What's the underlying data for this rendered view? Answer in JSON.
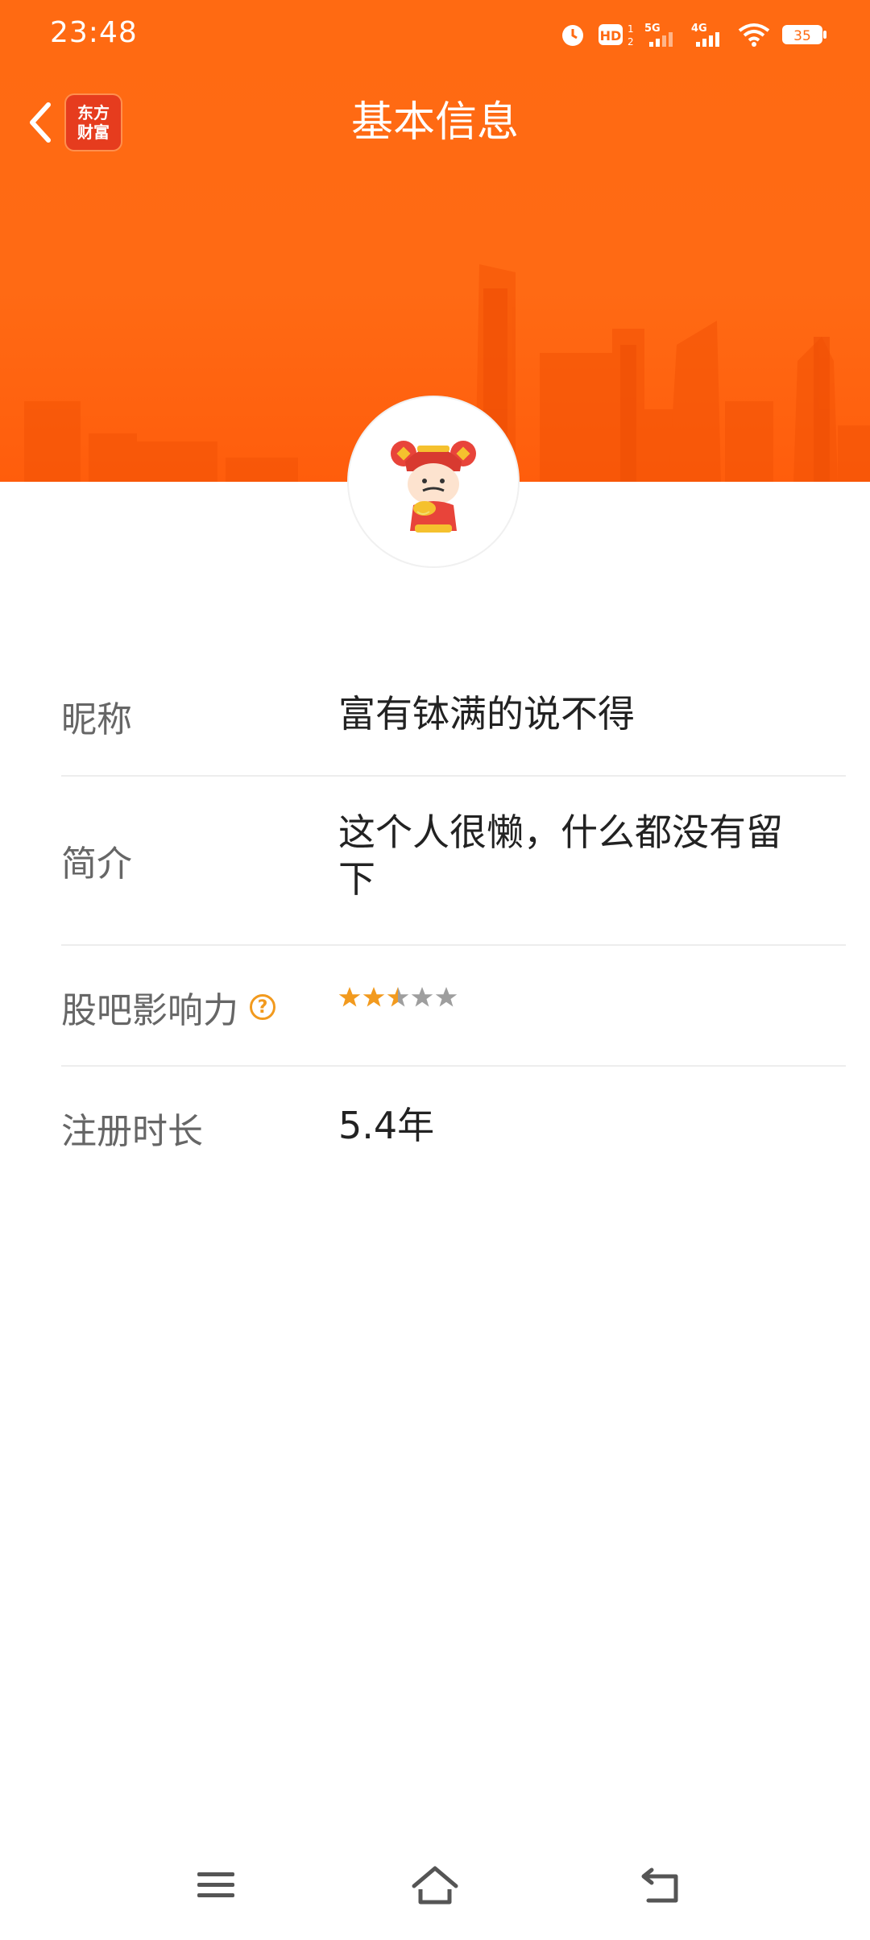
{
  "status_bar": {
    "time": "23:48",
    "icons": [
      "alarm-icon",
      "hd-voice-icon",
      "signal-5g-icon",
      "signal-4g-icon",
      "wifi-icon",
      "battery-icon"
    ],
    "battery": "35",
    "hd_label": "HD",
    "net1_label": "5G",
    "net2_label": "4G"
  },
  "nav": {
    "title": "基本信息",
    "logo_line1": "东方",
    "logo_line2": "财富"
  },
  "colors": {
    "header": "#ff6a12",
    "star_active": "#f29a1e",
    "star_inactive": "#9e9e9e"
  },
  "profile": {
    "nickname_label": "昵称",
    "nickname": "富有钵满的说不得",
    "bio_label": "简介",
    "bio": "这个人很懒，什么都没有留下",
    "influence_label": "股吧影响力",
    "influence_stars": 2.5,
    "influence_max": 5,
    "registered_label": "注册时长",
    "registered": "5.4年"
  },
  "bottom_nav": [
    "menu-icon",
    "home-icon",
    "back-icon"
  ]
}
